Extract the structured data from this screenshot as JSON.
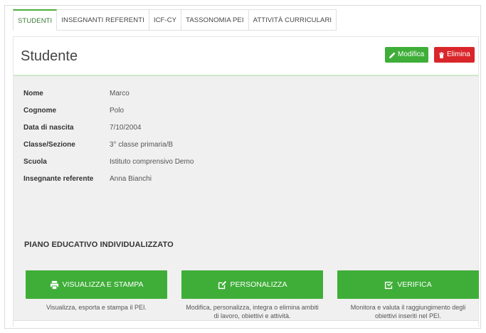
{
  "tabs": [
    {
      "label": "STUDENTI",
      "active": true
    },
    {
      "label": "INSEGNANTI REFERENTI",
      "active": false
    },
    {
      "label": "ICF-CY",
      "active": false
    },
    {
      "label": "TASSONOMIA PEI",
      "active": false
    },
    {
      "label": "ATTIVITÀ CURRICULARI",
      "active": false
    }
  ],
  "panel": {
    "title": "Studente",
    "edit_label": "Modifica",
    "delete_label": "Elimina"
  },
  "student": [
    {
      "label": "Nome",
      "value": "Marco"
    },
    {
      "label": "Cognome",
      "value": "Polo"
    },
    {
      "label": "Data di nascita",
      "value": "7/10/2004"
    },
    {
      "label": "Classe/Sezione",
      "value": "3° classe primaria/B"
    },
    {
      "label": "Scuola",
      "value": "Istituto comprensivo Demo"
    },
    {
      "label": "Insegnante referente",
      "value": "Anna Bianchi"
    }
  ],
  "pei": {
    "title": "PIANO EDUCATIVO INDIVIDUALIZZATO",
    "actions": [
      {
        "label": "VISUALIZZA E STAMPA",
        "icon": "print-icon",
        "desc": "Visualizza, esporta e stampa il PEI."
      },
      {
        "label": "PERSONALIZZA",
        "icon": "edit-icon",
        "desc": "Modifica, personalizza, integra o elimina ambiti di lavoro, obiettivi e attività."
      },
      {
        "label": "VERIFICA",
        "icon": "check-square-icon",
        "desc": "Monitora e valuta il raggiungimento degli obiettivi inseriti nel PEI."
      }
    ]
  },
  "colors": {
    "accent_green": "#3fae39",
    "danger_red": "#d9262a"
  }
}
